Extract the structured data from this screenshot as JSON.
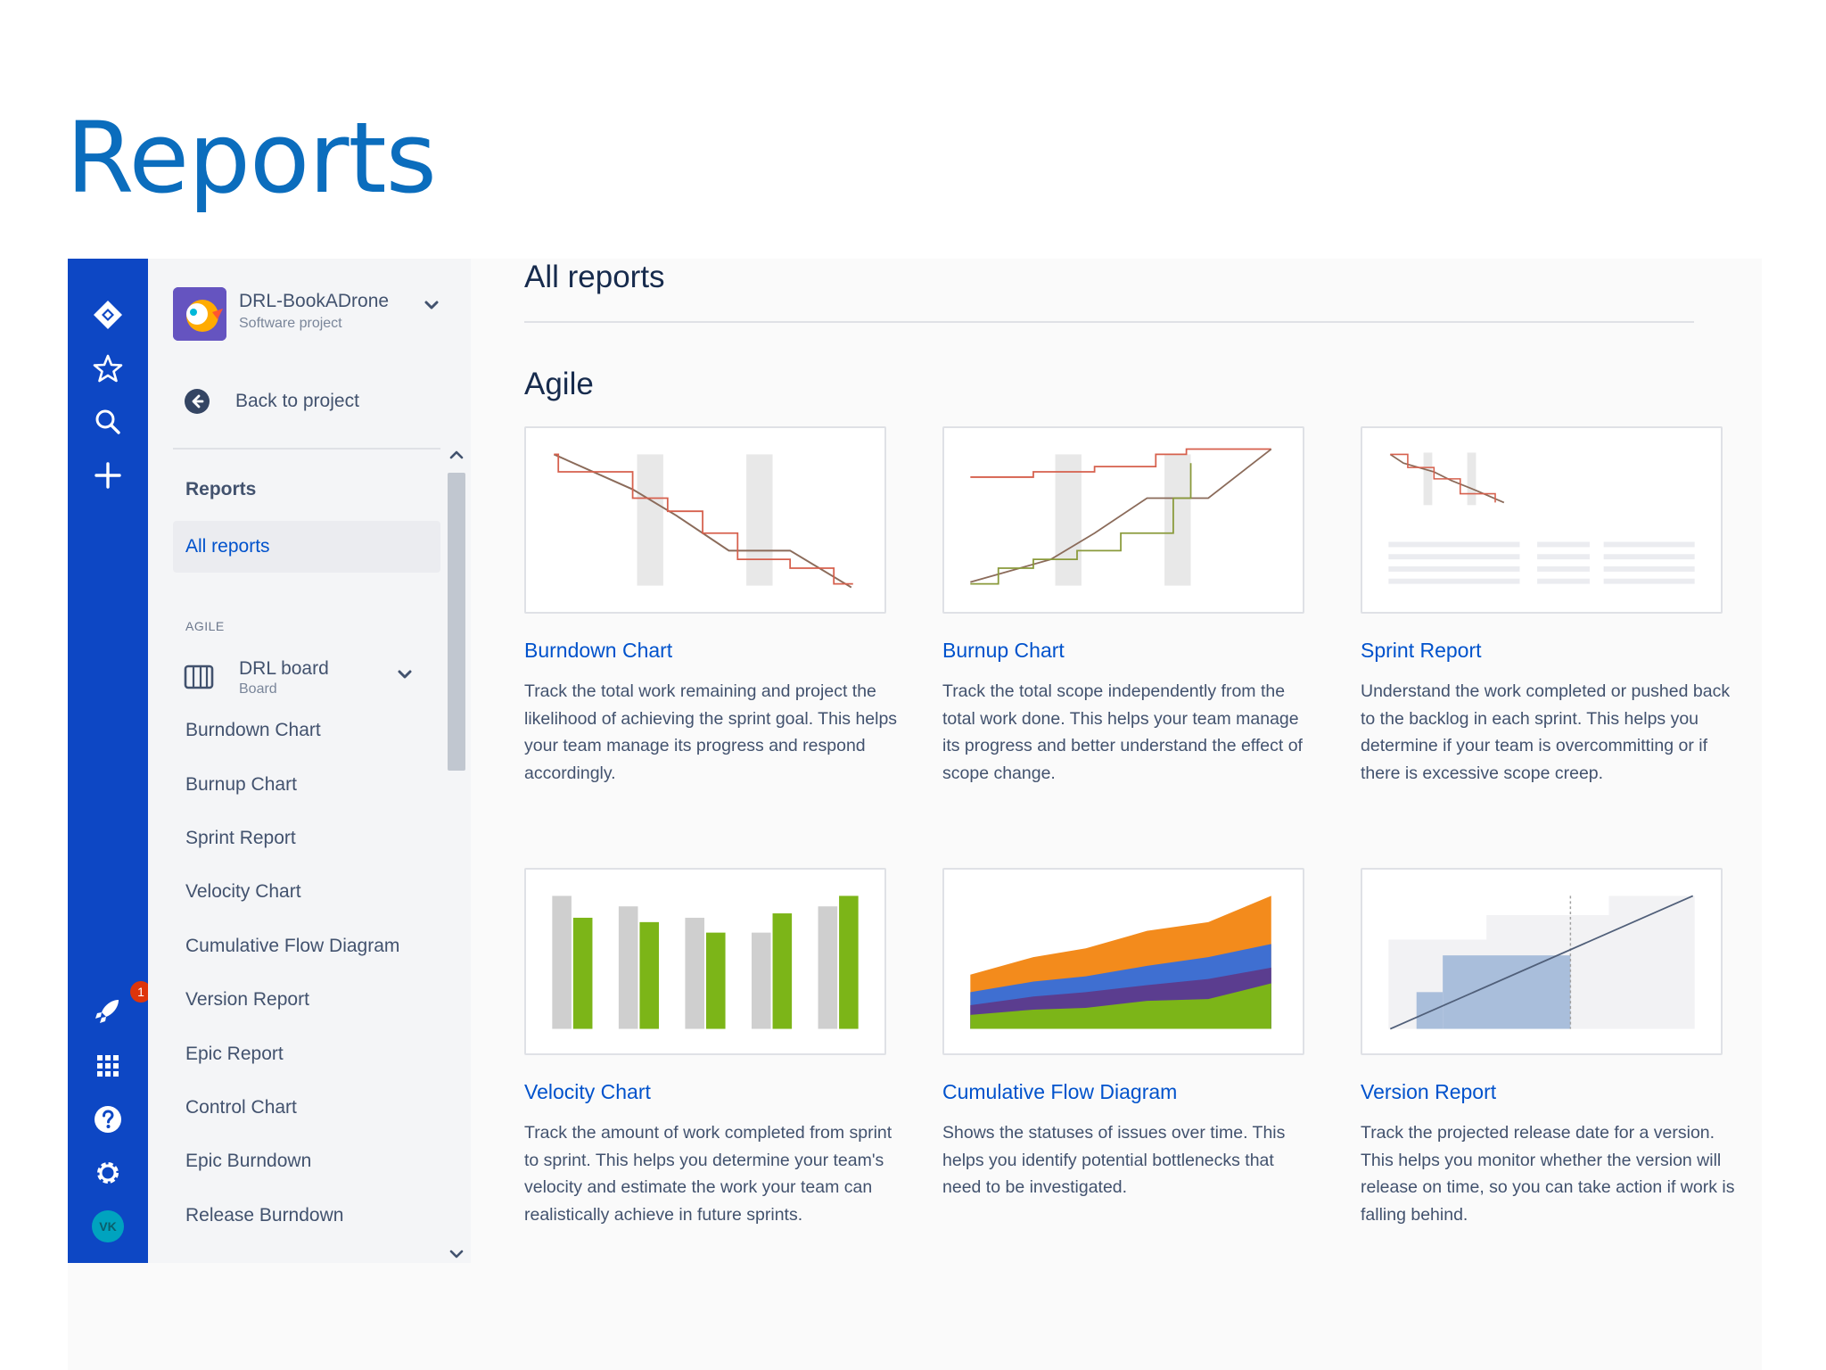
{
  "slide": {
    "title": "Reports"
  },
  "global_nav": {
    "notification_count": "1",
    "avatar_initials": "VK"
  },
  "project": {
    "name": "DRL-BookADrone",
    "type": "Software project",
    "back_label": "Back to project"
  },
  "sidebar": {
    "reports_label": "Reports",
    "all_reports_label": "All reports",
    "section_label": "AGILE",
    "board": {
      "name": "DRL board",
      "type": "Board"
    },
    "items": [
      "Burndown Chart",
      "Burnup Chart",
      "Sprint Report",
      "Velocity Chart",
      "Cumulative Flow Diagram",
      "Version Report",
      "Epic Report",
      "Control Chart",
      "Epic Burndown",
      "Release Burndown"
    ]
  },
  "main": {
    "heading": "All reports",
    "section_heading": "Agile",
    "cards": [
      {
        "title": "Burndown Chart",
        "description": "Track the total work remaining and project the likelihood of achieving the sprint goal. This helps your team manage its progress and respond accordingly."
      },
      {
        "title": "Burnup Chart",
        "description": "Track the total scope independently from the total work done. This helps your team manage its progress and better understand the effect of scope change."
      },
      {
        "title": "Sprint Report",
        "description": "Understand the work completed or pushed back to the backlog in each sprint. This helps you determine if your team is overcommitting or if there is excessive scope creep."
      },
      {
        "title": "Velocity Chart",
        "description": "Track the amount of work completed from sprint to sprint. This helps you determine your team's velocity and estimate the work your team can realistically achieve in future sprints."
      },
      {
        "title": "Cumulative Flow Diagram",
        "description": "Shows the statuses of issues over time. This helps you identify potential bottlenecks that need to be investigated."
      },
      {
        "title": "Version Report",
        "description": "Track the projected release date for a version. This helps you monitor whether the version will release on time, so you can take action if work is falling behind."
      }
    ]
  },
  "colors": {
    "slide_title": "#0b6dbd",
    "global_nav_bg": "#0d47c4",
    "link": "#0052cc",
    "burndown_guide": "#8b6b5a",
    "burndown_actual": "#d6604d",
    "burnup_scope": "#d6604d",
    "burnup_done": "#8a9a3b",
    "velocity_commitment": "#cfcfcf",
    "velocity_completed": "#7cb518",
    "cfd_orange": "#f38b1c",
    "cfd_blue": "#3f6fd1",
    "cfd_purple": "#5b3d8f",
    "cfd_green": "#7cb518",
    "version_fill": "#a9bedb"
  },
  "icons": [
    "jira-logo-icon",
    "star-icon",
    "search-icon",
    "plus-icon",
    "rocket-icon",
    "app-switcher-icon",
    "help-icon",
    "gear-icon",
    "arrow-left-icon",
    "chevron-down-icon",
    "board-icon",
    "chevron-up-icon"
  ]
}
